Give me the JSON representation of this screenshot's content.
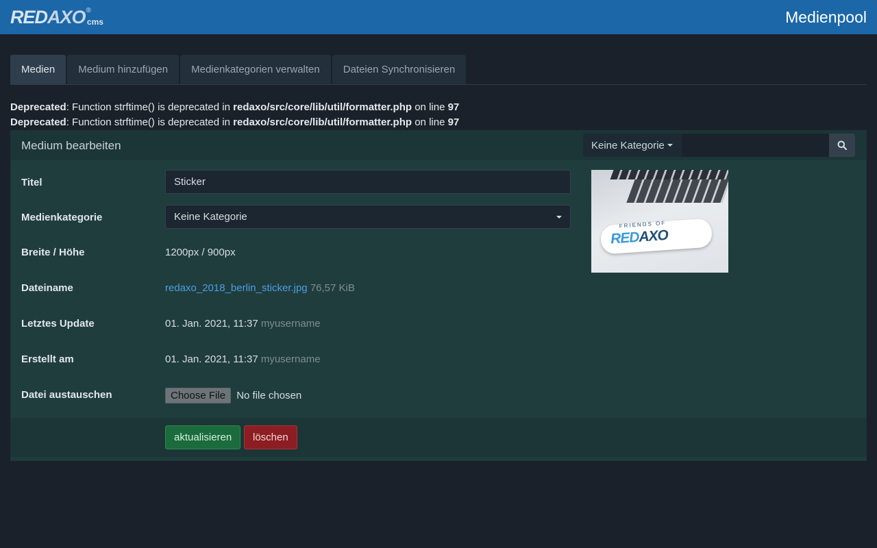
{
  "header": {
    "logo_main": "RED",
    "logo_axo": "AXO",
    "logo_reg": "®",
    "logo_cms": "cms",
    "page_title": "Medienpool"
  },
  "tabs": [
    {
      "label": "Medien",
      "active": true
    },
    {
      "label": "Medium hinzufügen",
      "active": false
    },
    {
      "label": "Medienkategorien verwalten",
      "active": false
    },
    {
      "label": "Dateien Synchronisieren",
      "active": false
    }
  ],
  "warnings": [
    {
      "type": "Deprecated",
      "text": ": Function strftime() is deprecated in ",
      "file": "redaxo/src/core/lib/util/formatter.php",
      "online": " on line ",
      "line": "97"
    },
    {
      "type": "Deprecated",
      "text": ": Function strftime() is deprecated in ",
      "file": "redaxo/src/core/lib/util/formatter.php",
      "online": " on line ",
      "line": "97"
    }
  ],
  "panel": {
    "title": "Medium bearbeiten",
    "category_filter": "Keine Kategorie",
    "search_value": "",
    "search_icon": "search-icon"
  },
  "form": {
    "title_label": "Titel",
    "title_value": "Sticker",
    "category_label": "Medienkategorie",
    "category_value": "Keine Kategorie",
    "size_label": "Breite / Höhe",
    "size_value": "1200px / 900px",
    "filename_label": "Dateiname",
    "filename_value": "redaxo_2018_berlin_sticker.jpg",
    "filesize": "76,57 KiB",
    "updated_label": "Letztes Update",
    "updated_value": "01. Jan. 2021, 11:37",
    "updated_user": "myusername",
    "created_label": "Erstellt am",
    "created_value": "01. Jan. 2021, 11:37",
    "created_user": "myusername",
    "replace_label": "Datei austauschen",
    "choose_file": "Choose File",
    "no_file": "No file chosen"
  },
  "preview": {
    "sticker_top": "FRIENDS OF",
    "sticker_red": "RED",
    "sticker_axo": "AXO"
  },
  "actions": {
    "save": "aktualisieren",
    "delete": "löschen"
  },
  "colors": {
    "header_bg": "#1b67a8",
    "page_bg": "#1a212b",
    "panel_bg": "#203d3e",
    "save_btn": "#1b6b3c",
    "delete_btn": "#8c1d22",
    "link": "#4a9fe0"
  }
}
